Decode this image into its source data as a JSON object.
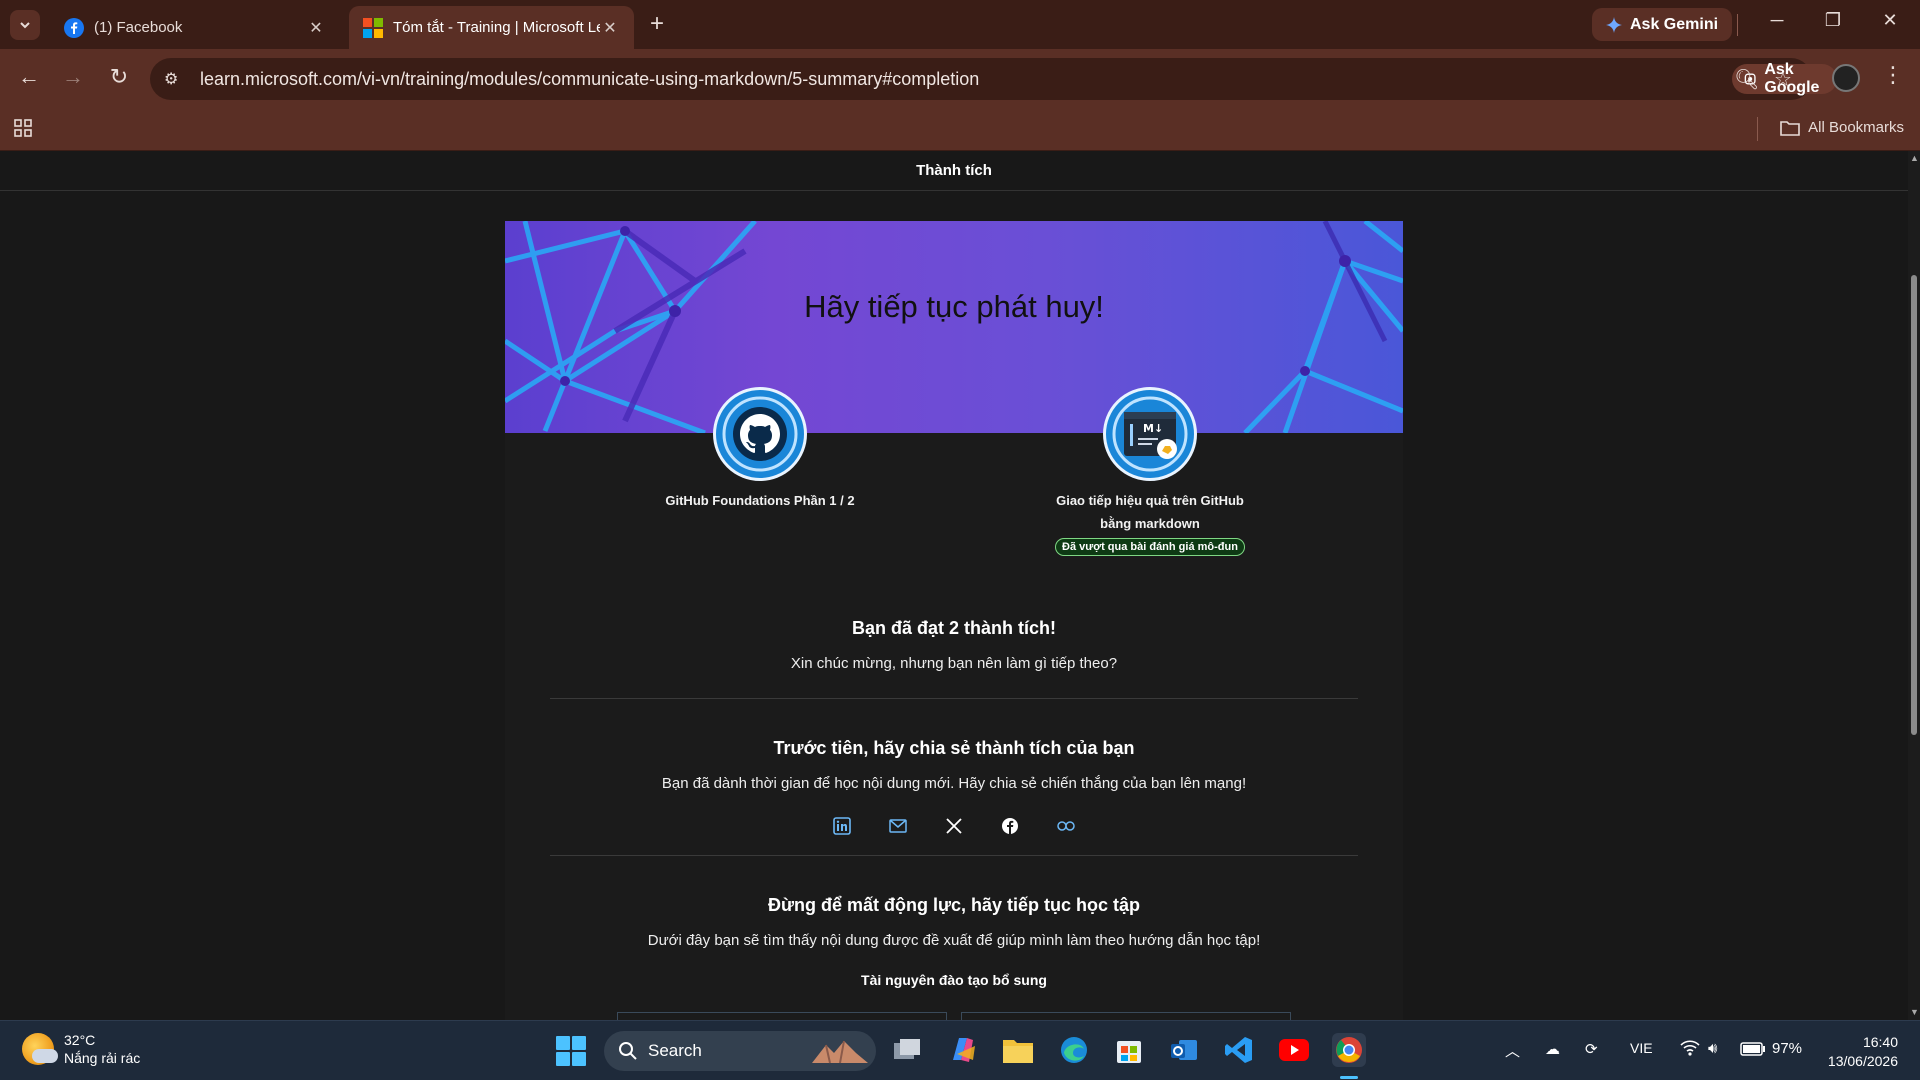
{
  "browser": {
    "tabs": [
      {
        "title": "(1) Facebook",
        "active": false
      },
      {
        "title": "Tóm tắt - Training | Microsoft Learn",
        "active": true
      }
    ],
    "ask_gemini": "Ask Gemini",
    "url": "learn.microsoft.com/vi-vn/training/modules/communicate-using-markdown/5-summary#completion",
    "ask_google": "Ask Google",
    "all_bookmarks": "All Bookmarks"
  },
  "page": {
    "header": "Thành tích",
    "banner_title": "Hãy tiếp tục phát huy!",
    "badges": [
      {
        "name": "GitHub Foundations Phần 1 / 2",
        "icon": "github-icon"
      },
      {
        "name_line1": "Giao tiếp hiệu quả trên GitHub",
        "name_line2": "bằng markdown",
        "status": "Đã vượt qua bài đánh giá mô-đun",
        "icon": "markdown-icon"
      }
    ],
    "achievements": {
      "title": "Bạn đã đạt 2 thành tích!",
      "subtitle": "Xin chúc mừng, nhưng bạn nên làm gì tiếp theo?"
    },
    "share": {
      "title": "Trước tiên, hãy chia sẻ thành tích của bạn",
      "subtitle": "Bạn đã dành thời gian để học nội dung mới. Hãy chia sẻ chiến thắng của bạn lên mạng!",
      "icons": [
        "linkedin-icon",
        "email-icon",
        "x-icon",
        "facebook-icon",
        "link-icon"
      ]
    },
    "keep_learning": {
      "title": "Đừng để mất động lực, hãy tiếp tục học tập",
      "subtitle": "Dưới đây bạn sẽ tìm thấy nội dung được đề xuất để giúp mình làm theo hướng dẫn học tập!",
      "resources_label": "Tài nguyên đào tạo bổ sung"
    }
  },
  "taskbar": {
    "weather_temp": "32°C",
    "weather_desc": "Nắng rải rác",
    "search_placeholder": "Search",
    "language": "VIE",
    "battery": "97%",
    "time": "16:40",
    "date": "13/06/2026"
  },
  "colors": {
    "chrome_dark": "#3a1d16",
    "chrome_light": "#5a2f25",
    "page_bg": "#181818",
    "badge_blue": "#1a86d8",
    "status_green": "#7fd884"
  }
}
